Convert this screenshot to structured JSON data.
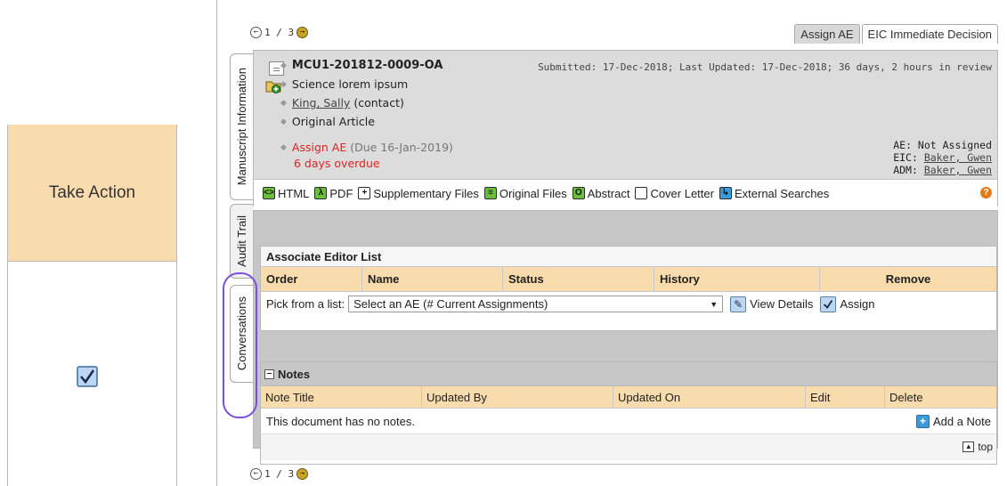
{
  "take_action": {
    "title": "Take Action"
  },
  "pager": {
    "top": "1 / 3",
    "bottom": "1 / 3"
  },
  "top_tabs": [
    "Assign AE",
    "EIC Immediate Decision"
  ],
  "side_tabs": [
    "Manuscript Information",
    "Audit Trail",
    "Conversations"
  ],
  "manuscript": {
    "id": "MCU1-201812-0009-OA",
    "submitted_info": "Submitted: 17-Dec-2018; Last Updated: 17-Dec-2018; 36 days, 2 hours in review",
    "title": "Science lorem ipsum",
    "contact_name": "King, Sally",
    "contact_suffix": "(contact)",
    "article_type": "Original Article",
    "task": "Assign AE",
    "task_due": "(Due 16-Jan-2019)",
    "overdue": "6 days overdue",
    "ae_label": "AE: Not Assigned",
    "eic_label": "EIC:",
    "eic_name": "Baker, Gwen",
    "adm_label": "ADM:",
    "adm_name": "Baker, Gwen"
  },
  "toolbar": {
    "html": "HTML",
    "pdf": "PDF",
    "supplementary": "Supplementary Files",
    "original": "Original Files",
    "abstract": "Abstract",
    "cover": "Cover Letter",
    "external": "External Searches"
  },
  "ae_list": {
    "title": "Associate Editor List",
    "columns": [
      "Order",
      "Name",
      "Status",
      "History",
      "Remove"
    ],
    "pick_label": "Pick from a list:",
    "select_value": "Select an AE (# Current Assignments)",
    "view_details": "View Details",
    "assign": "Assign"
  },
  "notes": {
    "title": "Notes",
    "columns": [
      "Note Title",
      "Updated By",
      "Updated On",
      "Edit",
      "Delete"
    ],
    "empty": "This document has no notes.",
    "add": "Add a Note",
    "top": "top"
  },
  "colors": {
    "tab_highlight": "#7b4ee0",
    "header_tan": "#f8dcae",
    "overdue_red": "#e02222"
  }
}
